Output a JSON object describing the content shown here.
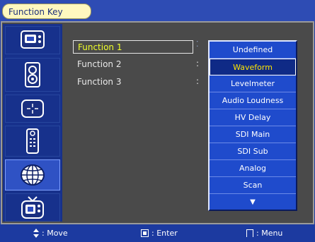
{
  "header": {
    "title": "Function Key"
  },
  "functions": [
    {
      "label": "Function 1",
      "selected": true
    },
    {
      "label": "Function 2",
      "selected": false
    },
    {
      "label": "Function 3",
      "selected": false
    }
  ],
  "options": [
    {
      "label": "Undefined",
      "selected": false
    },
    {
      "label": "Waveform",
      "selected": true
    },
    {
      "label": "Levelmeter",
      "selected": false
    },
    {
      "label": "Audio Loudness",
      "selected": false
    },
    {
      "label": "HV Delay",
      "selected": false
    },
    {
      "label": "SDI Main",
      "selected": false
    },
    {
      "label": "SDI Sub",
      "selected": false
    },
    {
      "label": "Analog",
      "selected": false
    },
    {
      "label": "Scan",
      "selected": false
    }
  ],
  "sidebar": {
    "icons": [
      "monitor-icon",
      "speaker-icon",
      "target-icon",
      "remote-icon",
      "globe-icon",
      "tv-icon"
    ],
    "active_index": 4
  },
  "footer": {
    "move_label": ": Move",
    "enter_label": ": Enter",
    "menu_label": ": Menu"
  },
  "colors": {
    "accent": "#1f4bcc",
    "highlight": "#f0ff2a",
    "title_bg": "#fff8bf"
  }
}
